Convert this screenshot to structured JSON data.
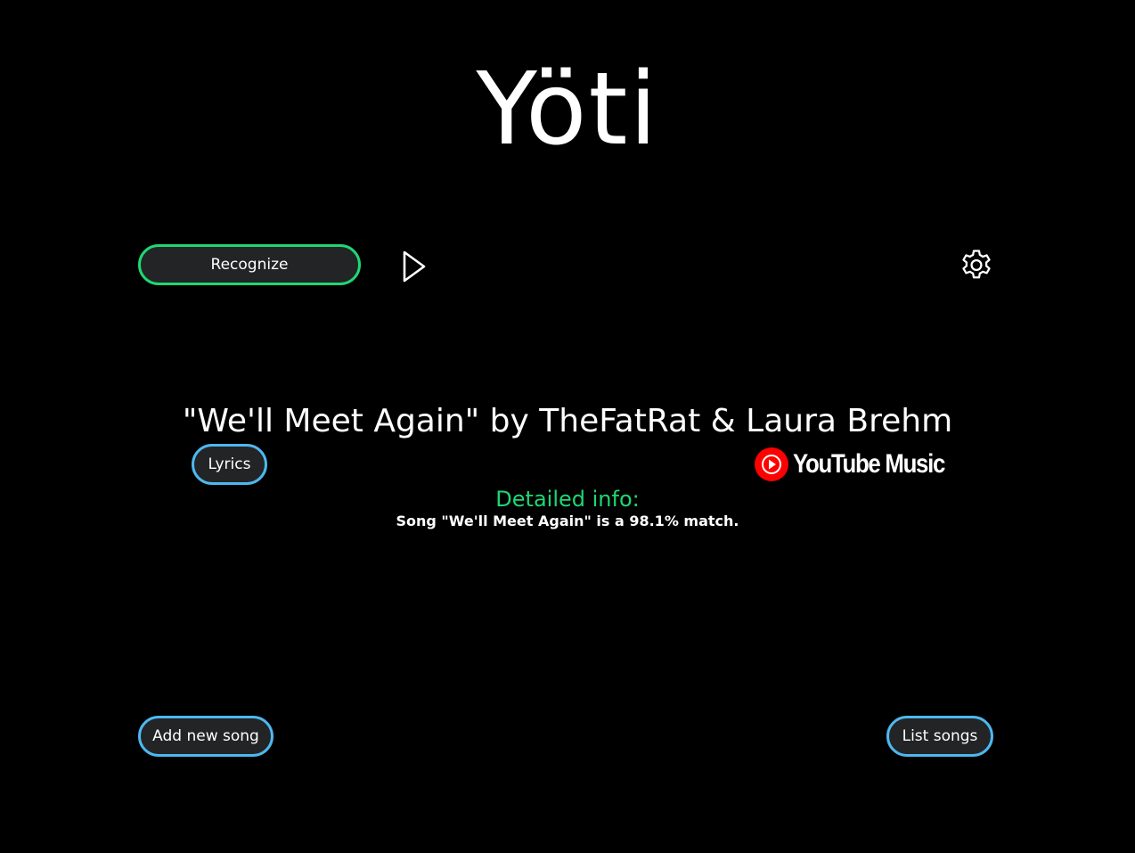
{
  "app": {
    "title": "Yöti"
  },
  "controls": {
    "recognize_label": "Recognize",
    "play_icon": "play-icon",
    "settings_icon": "gear-icon"
  },
  "result": {
    "song_line": "\"We'll Meet Again\" by TheFatRat & Laura Brehm",
    "lyrics_label": "Lyrics",
    "youtube_music_label": "YouTube Music",
    "detail_heading": "Detailed info:",
    "detail_text": "Song \"We'll Meet Again\" is a 98.1% match."
  },
  "footer": {
    "add_song_label": "Add new song",
    "list_songs_label": "List songs"
  },
  "colors": {
    "background": "#000000",
    "button_fill": "#232425",
    "accent_green": "#1ed773",
    "accent_blue": "#4db8f0",
    "youtube_red": "#ff0000"
  }
}
